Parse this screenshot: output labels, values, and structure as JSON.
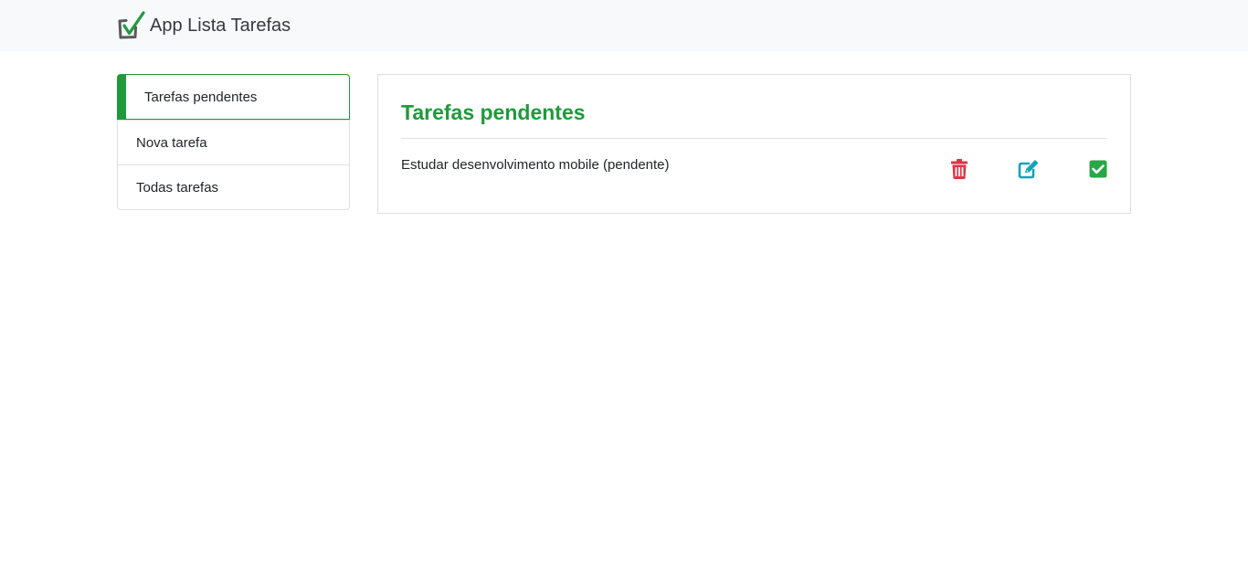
{
  "header": {
    "brand_title": "App Lista Tarefas",
    "logo_icon": "checkbox-check-icon"
  },
  "sidebar": {
    "items": [
      {
        "label": "Tarefas pendentes",
        "active": true
      },
      {
        "label": "Nova tarefa",
        "active": false
      },
      {
        "label": "Todas tarefas",
        "active": false
      }
    ]
  },
  "main": {
    "title": "Tarefas pendentes",
    "tasks": [
      {
        "text": "Estudar desenvolvimento mobile (pendente)",
        "actions": [
          {
            "icon": "trash-icon",
            "color": "#dc3545"
          },
          {
            "icon": "edit-icon",
            "color": "#17a2b8"
          },
          {
            "icon": "check-square-icon",
            "color": "#28a745"
          }
        ]
      }
    ]
  },
  "colors": {
    "accent_green": "#1f9a3b",
    "navbar_bg": "#f8f9fa",
    "danger": "#dc3545",
    "info": "#17a2b8",
    "success": "#28a745"
  }
}
